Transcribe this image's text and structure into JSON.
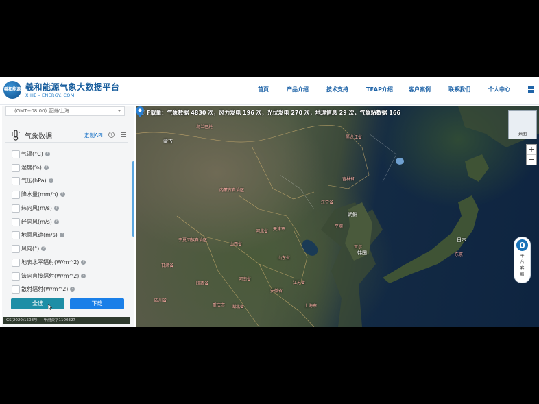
{
  "header": {
    "logo_text": "羲和能源",
    "title": "羲和能源气象大数据平台",
    "subtitle": "XIHE - ENERGY. COM",
    "nav": [
      {
        "label": "首页"
      },
      {
        "label": "产品介绍"
      },
      {
        "label": "技术支持"
      },
      {
        "label": "TEAP介绍"
      },
      {
        "label": "客户案例"
      },
      {
        "label": "联系我们"
      },
      {
        "label": "个人中心"
      }
    ],
    "apps_icon": "grid-icon",
    "accent_color": "#1f64a8"
  },
  "ticker": {
    "prefix": "F载量：",
    "text": "气象数据 4830 次，风力发电 196 次，光伏发电 270 次，地理信息 29 次，气象站数据 166"
  },
  "panel": {
    "timezone": "(GMT+08:00) 亚洲/上海",
    "title": "气象数据",
    "api_link": "定制API",
    "help_icon": "question-icon",
    "menu_icon": "menu-icon",
    "items": [
      {
        "label": "气温(°C)",
        "checked": false
      },
      {
        "label": "湿度(%)",
        "checked": false
      },
      {
        "label": "气压(hPa)",
        "checked": false
      },
      {
        "label": "降水量(mm/h)",
        "checked": false
      },
      {
        "label": "纬向风(m/s)",
        "checked": false
      },
      {
        "label": "经向风(m/s)",
        "checked": false
      },
      {
        "label": "地面风速(m/s)",
        "checked": false
      },
      {
        "label": "风向(°)",
        "checked": false
      },
      {
        "label": "地表水平辐射(W/m^2)",
        "checked": false
      },
      {
        "label": "法向直接辐射(W/m^2)",
        "checked": false
      },
      {
        "label": "散射辐射(W/m^2)",
        "checked": false
      }
    ],
    "select_all": "全选",
    "download": "下载",
    "attribution": "GS(2020)1508号 — 甲测资字1100327"
  },
  "map": {
    "labels": [
      {
        "text": "乌兰巴托",
        "kind": "red"
      },
      {
        "text": "蒙古",
        "kind": "white"
      },
      {
        "text": "黑龙江省",
        "kind": "red"
      },
      {
        "text": "吉林省",
        "kind": "red"
      },
      {
        "text": "内蒙古自治区",
        "kind": "red"
      },
      {
        "text": "辽宁省",
        "kind": "red"
      },
      {
        "text": "朝鲜",
        "kind": "white"
      },
      {
        "text": "平壤",
        "kind": "red"
      },
      {
        "text": "河北省",
        "kind": "red"
      },
      {
        "text": "天津市",
        "kind": "red"
      },
      {
        "text": "宁夏回族自治区",
        "kind": "red"
      },
      {
        "text": "山西省",
        "kind": "red"
      },
      {
        "text": "首尔",
        "kind": "red"
      },
      {
        "text": "韩国",
        "kind": "white"
      },
      {
        "text": "日本",
        "kind": "white"
      },
      {
        "text": "甘肃省",
        "kind": "red"
      },
      {
        "text": "山东省",
        "kind": "red"
      },
      {
        "text": "东京",
        "kind": "red"
      },
      {
        "text": "陕西省",
        "kind": "red"
      },
      {
        "text": "河南省",
        "kind": "red"
      },
      {
        "text": "江苏省",
        "kind": "red"
      },
      {
        "text": "安徽省",
        "kind": "red"
      },
      {
        "text": "四川省",
        "kind": "red"
      },
      {
        "text": "重庆市",
        "kind": "red"
      },
      {
        "text": "湖北省",
        "kind": "red"
      },
      {
        "text": "上海市",
        "kind": "red"
      }
    ],
    "minimap_label": "地图",
    "zoom_in": "+",
    "zoom_out": "−",
    "service": [
      "平",
      "台",
      "客",
      "服"
    ]
  }
}
